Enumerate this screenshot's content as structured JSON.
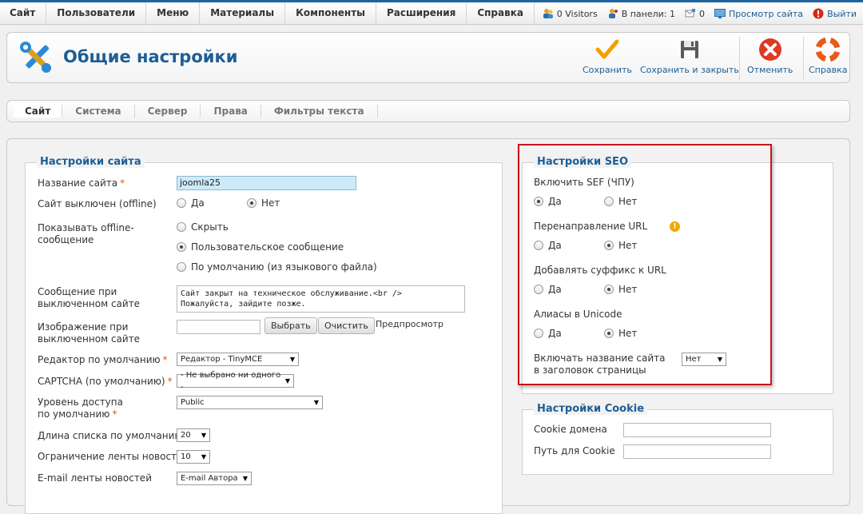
{
  "menu": {
    "items": [
      "Сайт",
      "Пользователи",
      "Меню",
      "Материалы",
      "Компоненты",
      "Расширения",
      "Справка"
    ]
  },
  "status": {
    "visitors": "0 Visitors",
    "panel": "В панели: 1",
    "messages": "0",
    "view_site": "Просмотр сайта",
    "logout": "Выйти"
  },
  "toolbar": {
    "title": "Общие настройки",
    "save": "Сохранить",
    "save_close": "Сохранить и закрыть",
    "cancel": "Отменить",
    "help": "Справка"
  },
  "tabs": [
    "Сайт",
    "Система",
    "Сервер",
    "Права",
    "Фильтры текста"
  ],
  "site": {
    "legend": "Настройки сайта",
    "sitename_label": "Название сайта",
    "sitename_value": "joomla25",
    "offline_label": "Сайт выключен (offline)",
    "yes": "Да",
    "no": "Нет",
    "show_offline_label_1": "Показывать offline-",
    "show_offline_label_2": "сообщение",
    "opt_hide": "Скрыть",
    "opt_custom": "Пользовательское сообщение",
    "opt_default": "По умолчанию (из языкового файла)",
    "offline_msg_label_1": "Сообщение при",
    "offline_msg_label_2": "выключенном сайте",
    "offline_msg_value": "Сайт закрыт на техническое обслуживание.<br />\nПожалуйста, зайдите позже.",
    "offline_img_label_1": "Изображение при",
    "offline_img_label_2": "выключенном сайте",
    "btn_select": "Выбрать",
    "btn_clear": "Очистить",
    "preview": "Предпросмотр",
    "editor_label": "Редактор по умолчанию",
    "editor_value": "Редактор - TinyMCE",
    "captcha_label": "CAPTCHA (по умолчанию)",
    "captcha_value": "- Не выбрано ни одного -",
    "access_label_1": "Уровень доступа",
    "access_label_2": "по умолчанию",
    "access_value": "Public",
    "list_limit_label": "Длина списка по умолчанию",
    "list_limit_value": "20",
    "feed_limit_label": "Ограничение ленты новостей",
    "feed_limit_value": "10",
    "feed_email_label": "E-mail ленты новостей",
    "feed_email_value": "E-mail Автора"
  },
  "seo": {
    "legend": "Настройки SEO",
    "sef_label": "Включить SEF (ЧПУ)",
    "rewrite_label": "Перенаправление URL",
    "suffix_label": "Добавлять суффикс к URL",
    "unicode_label": "Алиасы в Unicode",
    "sitename_title_label_1": "Включать название сайта",
    "sitename_title_label_2": "в заголовок страницы",
    "sitename_title_value": "Нет",
    "yes": "Да",
    "no": "Нет"
  },
  "cookie": {
    "legend": "Настройки Cookie",
    "domain_label": "Cookie домена",
    "path_label": "Путь для Cookie"
  },
  "colors": {
    "accent": "#1d5e94",
    "highlight_border": "#c9141d",
    "required": "#e25a00"
  }
}
